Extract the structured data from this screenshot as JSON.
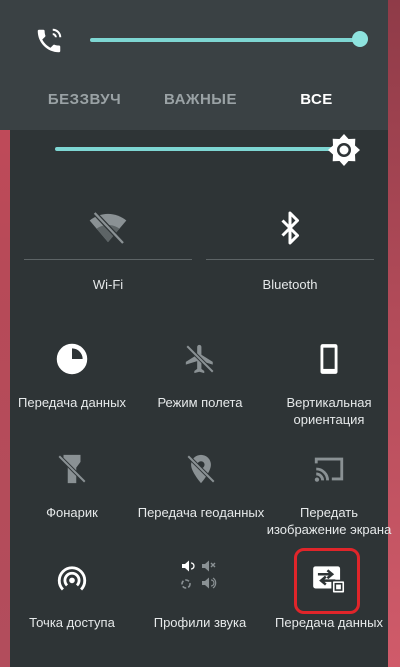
{
  "volume": {
    "level_fraction": 1.0,
    "modes": [
      {
        "label": "БЕЗЗВУЧ",
        "active": false
      },
      {
        "label": "ВАЖНЫЕ",
        "active": false
      },
      {
        "label": "ВСЕ",
        "active": true
      }
    ]
  },
  "brightness": {
    "level_fraction": 0.95
  },
  "tiles": {
    "wifi": {
      "label": "Wi-Fi",
      "icon": "wifi-off-icon"
    },
    "bluetooth": {
      "label": "Bluetooth",
      "icon": "bluetooth-icon"
    },
    "data_usage": {
      "label": "Передача данных",
      "icon": "data-usage-icon"
    },
    "airplane": {
      "label": "Режим полета",
      "icon": "airplane-icon"
    },
    "rotation": {
      "label_1": "Вертикальная",
      "label_2": "ориентация",
      "icon": "portrait-icon"
    },
    "flashlight": {
      "label": "Фонарик",
      "icon": "flashlight-off-icon"
    },
    "location": {
      "label": "Передача геоданных",
      "icon": "location-off-icon"
    },
    "cast": {
      "label_1": "Передать",
      "label_2": "изображение экрана",
      "icon": "cast-icon"
    },
    "hotspot": {
      "label": "Точка доступа",
      "icon": "hotspot-icon"
    },
    "sound_profiles": {
      "label": "Профили звука",
      "icon": "sound-profile-icon"
    },
    "data_transfer": {
      "label": "Передача данных",
      "icon": "data-transfer-icon"
    }
  },
  "colors": {
    "accent": "#7ed6d3",
    "highlight": "#e0252a",
    "panel": "#2e3436"
  }
}
